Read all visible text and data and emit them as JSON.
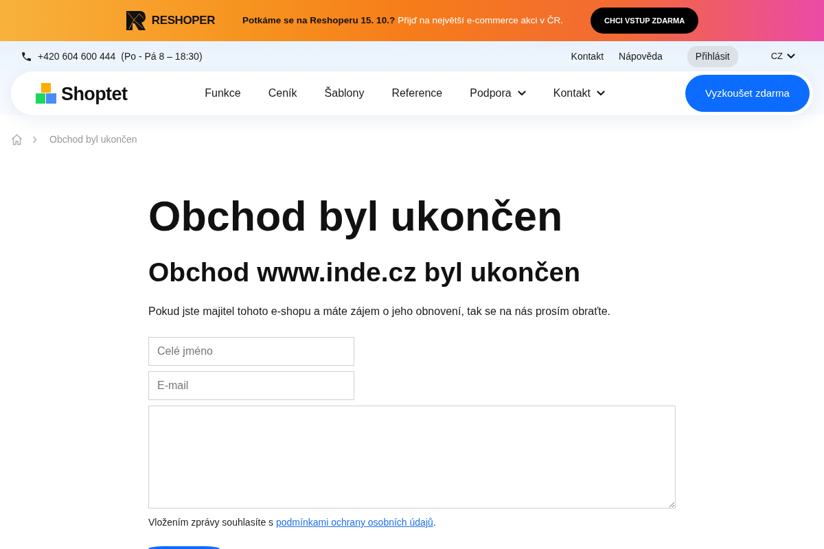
{
  "promo_banner": {
    "brand": "RESHOPER",
    "headline": "Potkáme se na Reshoperu 15. 10.?",
    "subline": "Přijď na největší e-commerce akci v ČR.",
    "button": "CHCI VSTUP ZDARMA"
  },
  "top_bar": {
    "phone": "+420 604 600 444",
    "hours": "(Po - Pá 8 – 18:30)",
    "links": [
      "Kontakt",
      "Nápověda"
    ],
    "login": "Přihlásit",
    "language": "CZ"
  },
  "navbar": {
    "brand": "Shoptet",
    "items": [
      {
        "label": "Funkce",
        "dropdown": false
      },
      {
        "label": "Ceník",
        "dropdown": false
      },
      {
        "label": "Šablony",
        "dropdown": false
      },
      {
        "label": "Reference",
        "dropdown": false
      },
      {
        "label": "Podpora",
        "dropdown": true
      },
      {
        "label": "Kontakt",
        "dropdown": true
      }
    ],
    "cta": "Vyzkoušet zdarma"
  },
  "breadcrumb": [
    "Obchod byl ukončen"
  ],
  "page": {
    "title": "Obchod byl ukončen",
    "subtitle": "Obchod www.inde.cz byl ukončen",
    "intro": "Pokud jste majitel tohoto e-shopu a máte zájem o jeho obnovení, tak se na nás prosím obraťte.",
    "form": {
      "fields": [
        {
          "kind": "input",
          "placeholder": "Celé jméno"
        },
        {
          "kind": "input",
          "placeholder": "E-mail"
        },
        {
          "kind": "textarea"
        }
      ],
      "consent": {
        "text": "Vložením zprávy souhlasíte s ",
        "link": "podmínkami ochrany osobních údajů",
        "after": "."
      }
    }
  }
}
